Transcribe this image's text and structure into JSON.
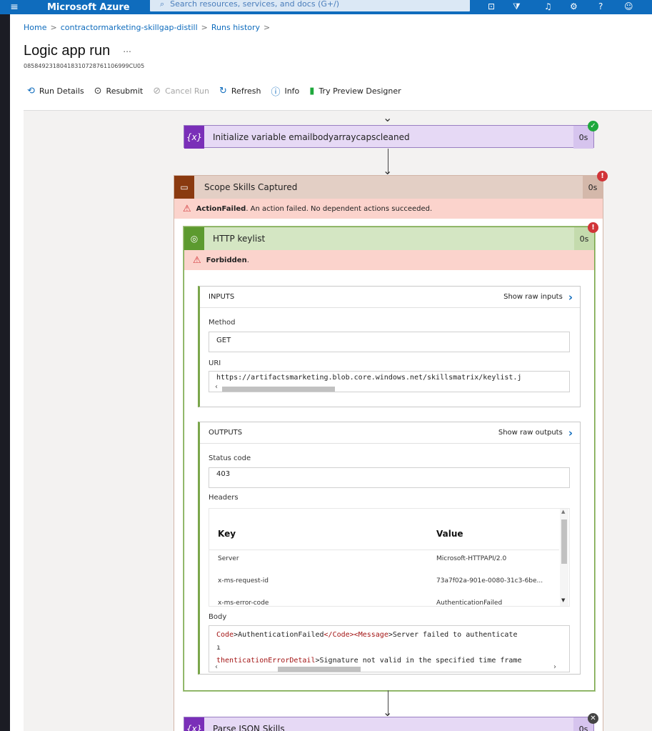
{
  "topbar": {
    "menu_icon": "hamburger-icon",
    "brand": "Microsoft Azure",
    "search_placeholder": "Search resources, services, and docs (G+/)",
    "icons": [
      "cloud-shell-icon",
      "directory-filter-icon",
      "notifications-icon",
      "settings-icon",
      "help-icon",
      "feedback-icon"
    ]
  },
  "breadcrumb": {
    "home": "Home",
    "app": "contractormarketing-skillgap-distill",
    "history": "Runs history"
  },
  "page": {
    "title": "Logic app run",
    "more": "...",
    "run_id": "08584923180418310728761106999CU05"
  },
  "toolbar": {
    "run_details": "Run Details",
    "resubmit": "Resubmit",
    "cancel_run": "Cancel Run",
    "refresh": "Refresh",
    "info": "Info",
    "try_preview": "Try Preview Designer"
  },
  "steps": {
    "init_var": {
      "icon_text": "{x}",
      "label": "Initialize variable emailbodyarraycapscleaned",
      "duration": "0s",
      "status": "succeeded"
    },
    "scope": {
      "label": "Scope Skills Captured",
      "duration": "0s",
      "status": "failed",
      "error_title": "ActionFailed",
      "error_msg": ". An action failed. No dependent actions succeeded."
    },
    "http": {
      "label": "HTTP keylist",
      "duration": "0s",
      "status": "failed",
      "error_title": "Forbidden",
      "error_suffix": "."
    },
    "parse": {
      "icon_text": "{x}",
      "label": "Parse JSON Skills",
      "duration": "0s",
      "status": "skipped"
    }
  },
  "inputs": {
    "header": "INPUTS",
    "show_raw": "Show raw inputs",
    "method_label": "Method",
    "method_value": "GET",
    "uri_label": "URI",
    "uri_value": "https://artifactsmarketing.blob.core.windows.net/skillsmatrix/keylist.j"
  },
  "outputs": {
    "header": "OUTPUTS",
    "show_raw": "Show raw outputs",
    "status_label": "Status code",
    "status_value": "403",
    "headers_label": "Headers",
    "headers_table": {
      "columns": [
        "Key",
        "Value"
      ],
      "rows": [
        [
          "Server",
          "Microsoft-HTTPAPI/2.0"
        ],
        [
          "x-ms-request-id",
          "73a7f02a-901e-0080-31c3-6be..."
        ],
        [
          "x-ms-error-code",
          "AuthenticationFailed"
        ]
      ]
    },
    "body_label": "Body",
    "body_line1_a": "Code",
    "body_line1_b": ">AuthenticationFailed",
    "body_line1_c": "</Code><Message",
    "body_line1_d": ">Server failed to authenticate",
    "body_line2": "ı",
    "body_line3_a": "thenticationErrorDetail",
    "body_line3_b": ">Signature not valid in the specified time frame"
  },
  "colors": {
    "azure_blue": "#0f6cbd",
    "success_green": "#1ea83c",
    "error_red": "#d13438",
    "variable_purple": "#e6d9f5",
    "scope_tan": "#e3cfc5"
  }
}
